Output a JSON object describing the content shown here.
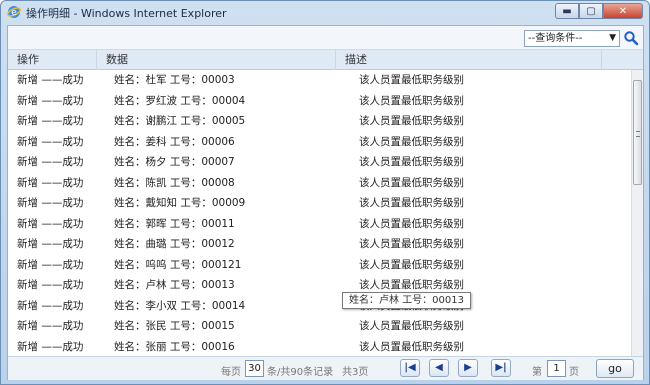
{
  "window": {
    "title": "操作明细 - Windows Internet Explorer",
    "min_symbol": "▬",
    "max_symbol": "▢",
    "close_symbol": "✕"
  },
  "toolbar": {
    "query_select_value": "--查询条件--",
    "query_select_arrow": "▼"
  },
  "columns": [
    "操作",
    "数据",
    "描述"
  ],
  "rows": [
    [
      "新增 ——成功",
      "姓名：杜军 工号：00003",
      "该人员置最低职务级别"
    ],
    [
      "新增 ——成功",
      "姓名：罗红波 工号：00004",
      "该人员置最低职务级别"
    ],
    [
      "新增 ——成功",
      "姓名：谢鹏江 工号：00005",
      "该人员置最低职务级别"
    ],
    [
      "新增 ——成功",
      "姓名：姜科 工号：00006",
      "该人员置最低职务级别"
    ],
    [
      "新增 ——成功",
      "姓名：杨夕 工号：00007",
      "该人员置最低职务级别"
    ],
    [
      "新增 ——成功",
      "姓名：陈凯 工号：00008",
      "该人员置最低职务级别"
    ],
    [
      "新增 ——成功",
      "姓名：戴知知 工号：00009",
      "该人员置最低职务级别"
    ],
    [
      "新增 ——成功",
      "姓名：郭晖 工号：00011",
      "该人员置最低职务级别"
    ],
    [
      "新增 ——成功",
      "姓名：曲璐 工号：00012",
      "该人员置最低职务级别"
    ],
    [
      "新增 ——成功",
      "姓名：呜呜 工号：000121",
      "该人员置最低职务级别"
    ],
    [
      "新增 ——成功",
      "姓名：卢林 工号：00013",
      "该人员置最低职务级别"
    ],
    [
      "新增 ——成功",
      "姓名：李小双 工号：00014",
      "该人员置最低职务级别"
    ],
    [
      "新增 ——成功",
      "姓名：张民 工号：00015",
      "该人员置最低职务级别"
    ],
    [
      "新增 ——成功",
      "姓名：张丽 工号：00016",
      "该人员置最低职务级别"
    ]
  ],
  "tooltip": "姓名：卢林 工号：00013",
  "pager": {
    "per_page_prefix": "每页",
    "per_page_value": "30",
    "per_page_suffix": "条/共90条记录",
    "total_pages": "共3页",
    "first": "|◀",
    "prev": "◀",
    "next": "▶",
    "last": "▶|",
    "page_prefix": "第",
    "page_value": "1",
    "page_suffix": "页",
    "go_label": "go"
  },
  "colors": {
    "header_bg": "#dfeaf5",
    "pager_button_text": "#1d3f8c",
    "search_icon": "#1f5fbf"
  }
}
